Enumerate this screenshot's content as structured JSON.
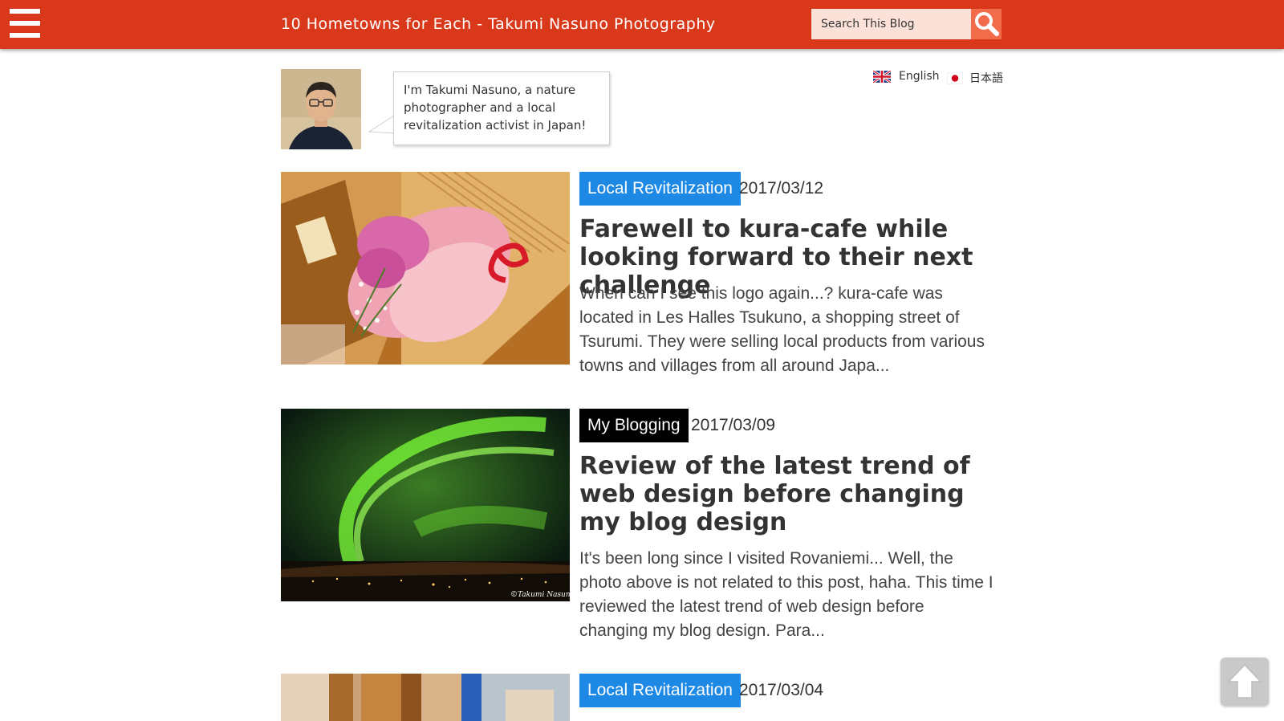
{
  "header": {
    "site_title": "10 Hometowns for Each - Takumi Nasuno Photography",
    "search_placeholder": "Search This Blog",
    "brand_color": "#d9391a"
  },
  "author": {
    "intro": "I'm Takumi Nasuno, a nature photographer and a local revitalization activist in Japan!"
  },
  "languages": [
    {
      "label": "English",
      "icon": "uk-flag-icon"
    },
    {
      "label": "日本語",
      "icon": "japan-flag-icon"
    }
  ],
  "posts": [
    {
      "category": "Local Revitalization",
      "category_color": "#1e88e5",
      "date": "2017/03/12",
      "title": "Farewell to kura-cafe while looking forward to their next challenge",
      "excerpt": "When can I see this logo again...?   kura-cafe was located in Les Halles Tsukuno, a shopping street of Tsurumi. They were selling local products from various towns and villages from all around Japa..."
    },
    {
      "category": "My Blogging",
      "category_color": "#000000",
      "date": "2017/03/09",
      "title": "Review of the latest trend of web design before changing my blog design",
      "excerpt": "It's been long since I visited Rovaniemi... Well, the photo above is not related to this post, haha. This time I reviewed the latest trend of web design before changing my blog design.   Para...",
      "photo_credit": "©Takumi Nasuno"
    },
    {
      "category": "Local Revitalization",
      "category_color": "#1e88e5",
      "date": "2017/03/04"
    }
  ],
  "scroll_top": {
    "icon": "arrow-up-icon"
  }
}
